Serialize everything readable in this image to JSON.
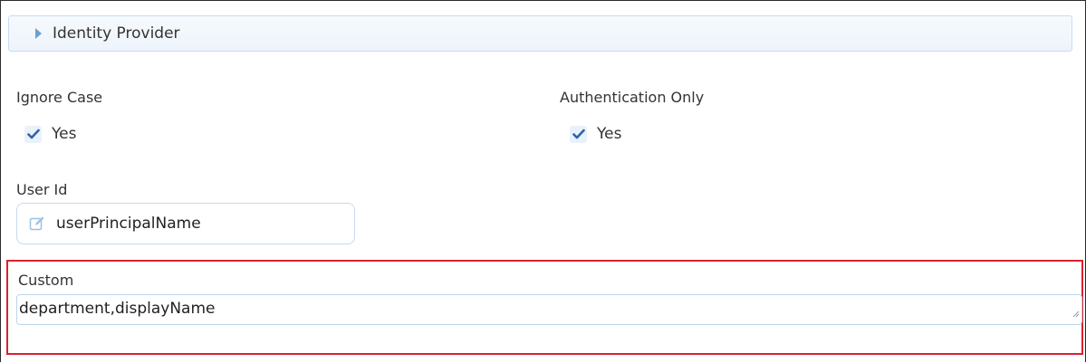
{
  "section": {
    "title": "Identity Provider"
  },
  "ignore_case": {
    "label": "Ignore Case",
    "option_label": "Yes",
    "checked": true
  },
  "authentication_only": {
    "label": "Authentication Only",
    "option_label": "Yes",
    "checked": true
  },
  "user_id": {
    "label": "User Id",
    "value": "userPrincipalName"
  },
  "custom": {
    "label": "Custom",
    "value": "department,displayName"
  },
  "colors": {
    "accent": "#3a6ea5",
    "highlight_border": "#d8222f",
    "field_border": "#c5daef"
  },
  "icons": {
    "collapse": "caret-right-icon",
    "checkbox": "checkmark-icon",
    "field": "edit-icon"
  }
}
